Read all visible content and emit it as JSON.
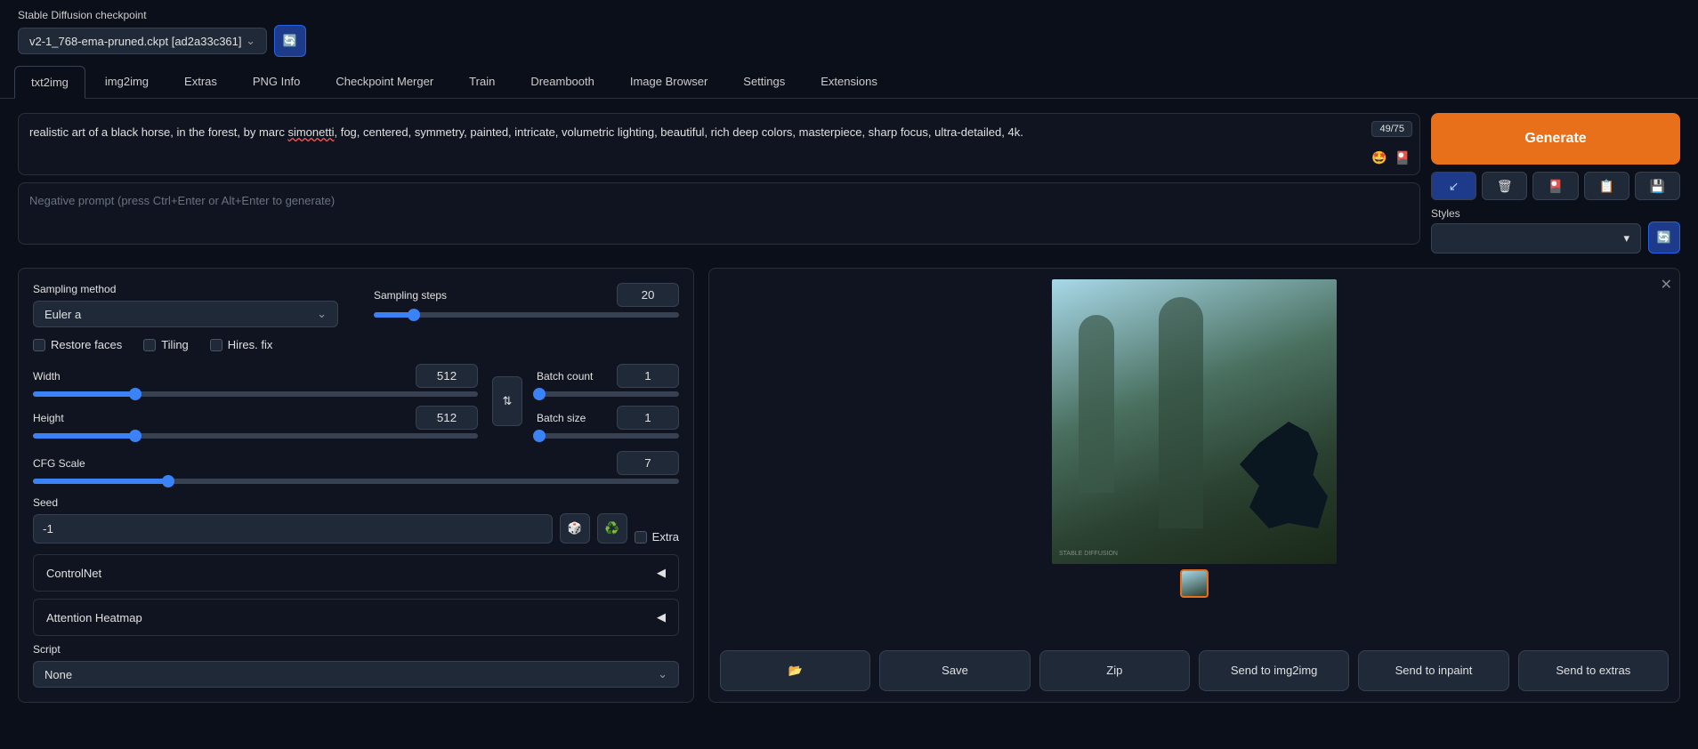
{
  "checkpoint": {
    "label": "Stable Diffusion checkpoint",
    "value": "v2-1_768-ema-pruned.ckpt [ad2a33c361]"
  },
  "tabs": [
    "txt2img",
    "img2img",
    "Extras",
    "PNG Info",
    "Checkpoint Merger",
    "Train",
    "Dreambooth",
    "Image Browser",
    "Settings",
    "Extensions"
  ],
  "active_tab": "txt2img",
  "prompt": {
    "text_before": "realistic art of a black horse, in the forest, by marc ",
    "text_underlined": "simonetti",
    "text_after": ", fog, centered, symmetry, painted, intricate, volumetric lighting, beautiful, rich deep colors, masterpiece, sharp focus, ultra-detailed, 4k.",
    "token_count": "49/75"
  },
  "negative_prompt": {
    "placeholder": "Negative prompt (press Ctrl+Enter or Alt+Enter to generate)"
  },
  "generate_label": "Generate",
  "styles_label": "Styles",
  "settings": {
    "sampling_method_label": "Sampling method",
    "sampling_method_value": "Euler a",
    "sampling_steps_label": "Sampling steps",
    "sampling_steps_value": "20",
    "restore_faces": "Restore faces",
    "tiling": "Tiling",
    "hires_fix": "Hires. fix",
    "width_label": "Width",
    "width_value": "512",
    "height_label": "Height",
    "height_value": "512",
    "batch_count_label": "Batch count",
    "batch_count_value": "1",
    "batch_size_label": "Batch size",
    "batch_size_value": "1",
    "cfg_label": "CFG Scale",
    "cfg_value": "7",
    "seed_label": "Seed",
    "seed_value": "-1",
    "extra_label": "Extra",
    "controlnet": "ControlNet",
    "attention": "Attention Heatmap",
    "script_label": "Script",
    "script_value": "None"
  },
  "actions": {
    "save": "Save",
    "zip": "Zip",
    "send_img2img": "Send to img2img",
    "send_inpaint": "Send to inpaint",
    "send_extras": "Send to extras"
  }
}
